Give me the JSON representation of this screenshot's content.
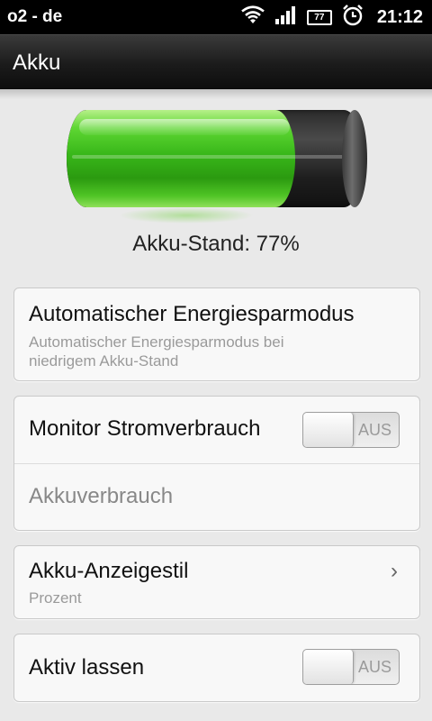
{
  "status_bar": {
    "carrier": "o2 - de",
    "battery_level": "77",
    "time": "21:12",
    "icons": [
      "wifi-icon",
      "signal-icon",
      "battery-icon",
      "alarm-icon"
    ]
  },
  "title_bar": {
    "title": "Akku"
  },
  "battery": {
    "level_text": "Akku-Stand: 77%",
    "level_fraction": 0.77,
    "fill_color": "#39b81a"
  },
  "settings": {
    "power_saving": {
      "title": "Automatischer Energiesparmodus",
      "subtitle_line1": "Automatischer Energiesparmodus bei",
      "subtitle_line2": "niedrigem Akku-Stand"
    },
    "monitor": {
      "title": "Monitor Stromverbrauch",
      "toggle_label": "AUS",
      "usage_label": "Akkuverbrauch"
    },
    "indicator_style": {
      "title": "Akku-Anzeigestil",
      "value": "Prozent",
      "chevron": "›"
    },
    "keep_awake": {
      "title": "Aktiv lassen",
      "toggle_label": "AUS"
    }
  }
}
